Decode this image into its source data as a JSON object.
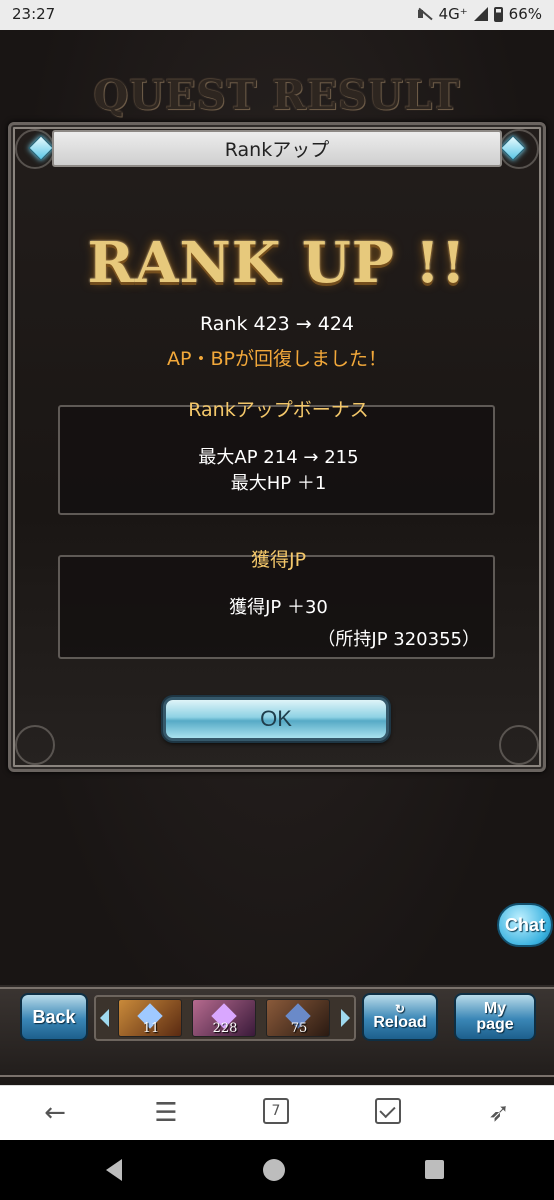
{
  "status_bar": {
    "time": "23:27",
    "network": "4G⁺",
    "battery": "66%"
  },
  "game": {
    "screen_title": "QUEST RESULT",
    "dialog_title": "Rankアップ",
    "banner": "RANK UP !!",
    "rank_line": "Rank 423 → 424",
    "recover_text": "AP・BPが回復しました！",
    "bonus": {
      "title": "Rankアップボーナス",
      "lines": [
        "最大AP 214 → 215",
        "最大HP ＋1"
      ]
    },
    "jp": {
      "title": "獲得JP",
      "gain": "獲得JP ＋30",
      "owned": "（所持JP 320355）"
    },
    "ok_label": "OK",
    "chat_label": "Chat"
  },
  "game_bar": {
    "back_label": "Back",
    "items": [
      {
        "count": "11",
        "color": "#8a5a2a"
      },
      {
        "count": "228",
        "color": "#6a4a7a"
      },
      {
        "count": "75",
        "color": "#5a3a2a"
      }
    ],
    "reload_label": "Reload",
    "mypage_label_1": "My",
    "mypage_label_2": "page"
  },
  "browser_bar": {
    "tab_count": "7"
  }
}
